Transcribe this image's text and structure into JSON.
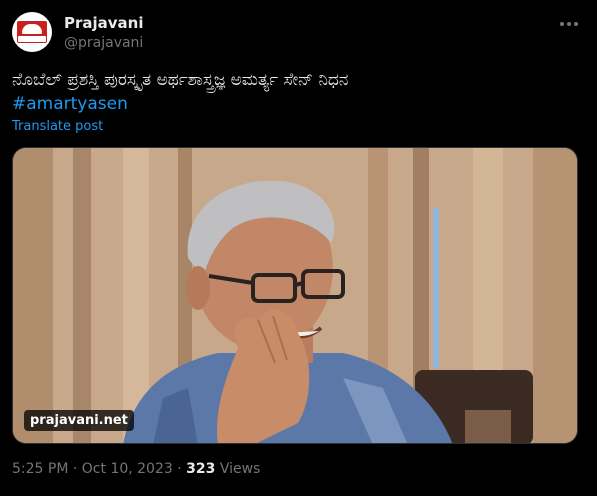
{
  "author": {
    "name": "Prajavani",
    "handle": "@prajavani",
    "avatar_icon": "prajavani-logo-icon"
  },
  "post": {
    "text": "ನೊಬೆಲ್ ಪ್ರಶಸ್ತಿ ಪುರಸ್ಕೃತ ಅರ್ಥಶಾಸ್ತ್ರಜ್ಞ ಅಮರ್ತ್ಯ ಸೇನ್ ನಿಧನ",
    "hashtag": "#amartyasen",
    "translate_label": "Translate post"
  },
  "media": {
    "watermark": "prajavani.net"
  },
  "meta": {
    "time": "5:25 PM",
    "separator": "·",
    "date": "Oct 10, 2023",
    "views_count": "323",
    "views_label": "Views"
  },
  "colors": {
    "background": "#000000",
    "text": "#e7e9ea",
    "secondary": "#71767b",
    "link": "#1d9bf0"
  }
}
